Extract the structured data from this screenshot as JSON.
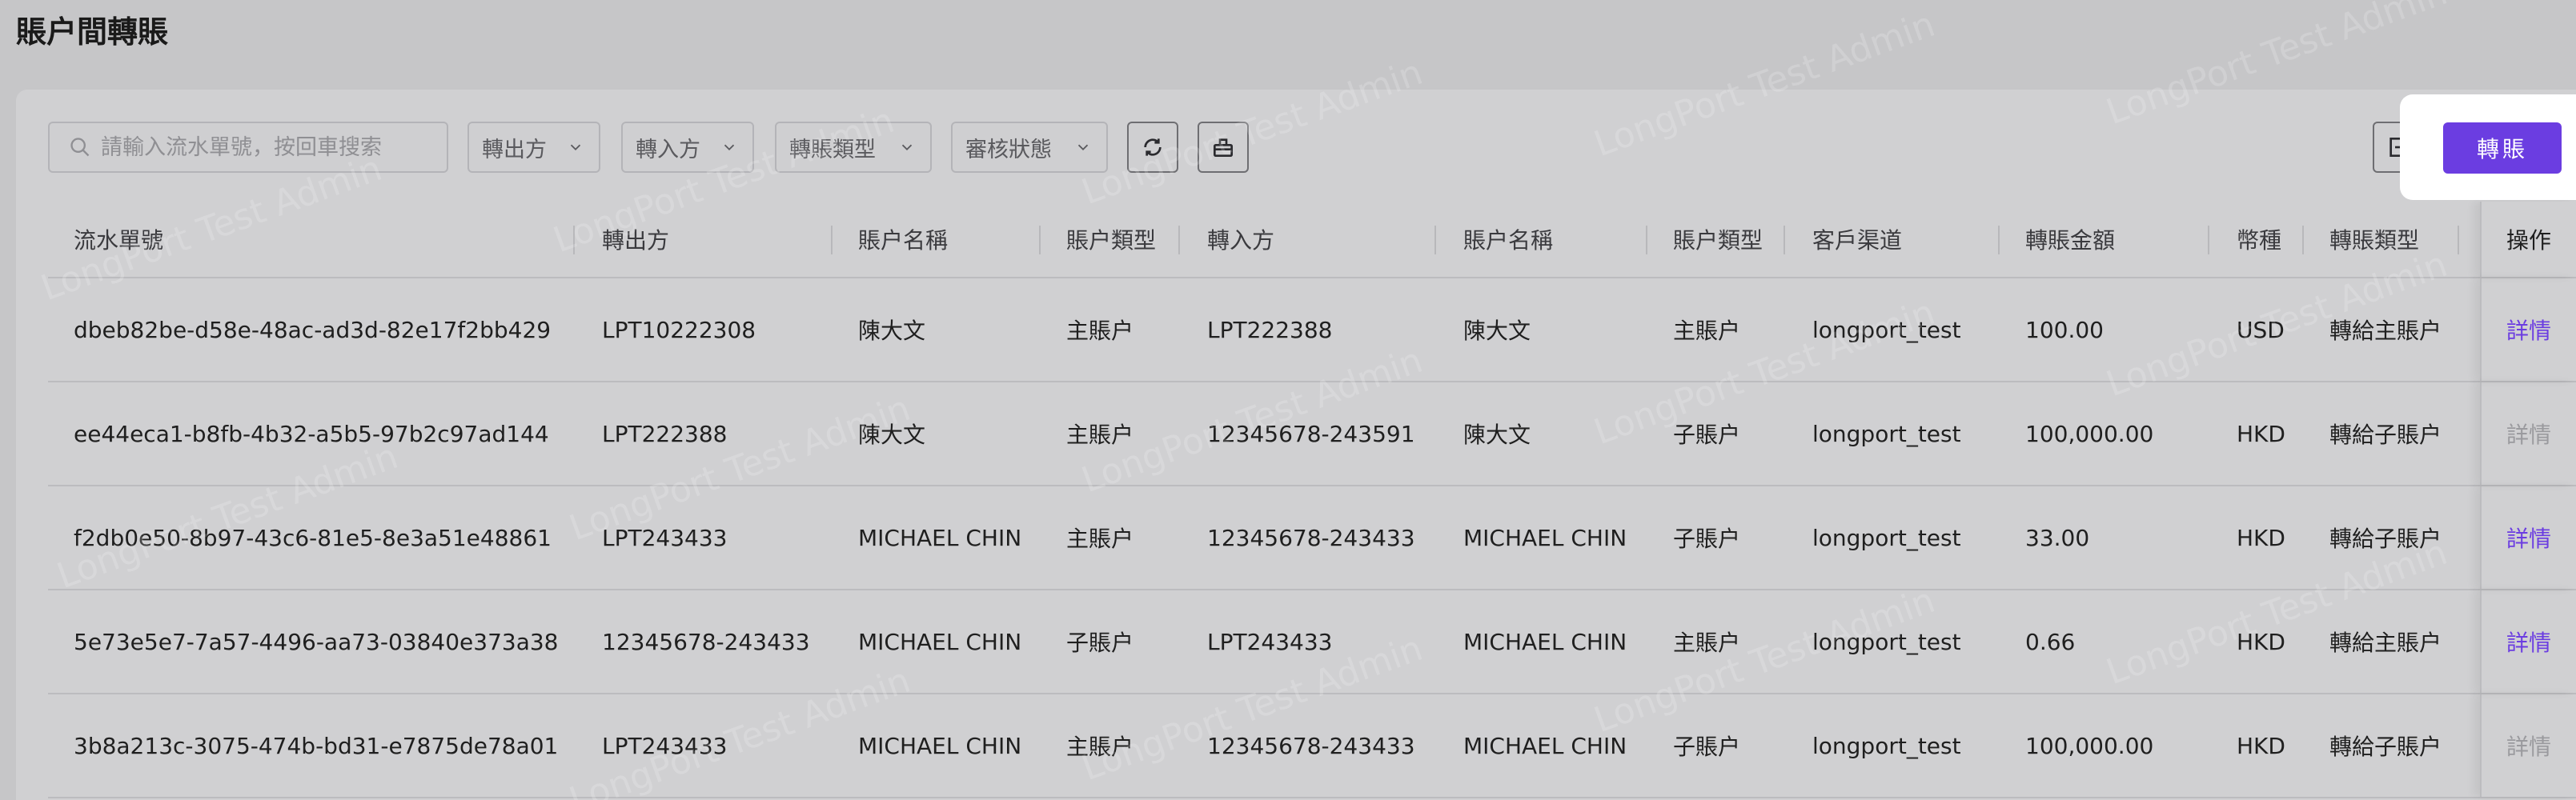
{
  "page": {
    "title": "賬户間轉賬"
  },
  "toolbar": {
    "search_placeholder": "請輸入流水單號，按回車搜索",
    "filters": [
      {
        "label": "轉出方"
      },
      {
        "label": "轉入方"
      },
      {
        "label": "轉賬類型"
      },
      {
        "label": "審核狀態"
      }
    ],
    "refresh_icon": "refresh-icon",
    "clear_icon": "eraser-icon",
    "export_icon": "export-icon",
    "transfer_label": "轉賬"
  },
  "table": {
    "columns": [
      "流水單號",
      "轉出方",
      "賬户名稱",
      "賬户類型",
      "轉入方",
      "賬户名稱",
      "賬户類型",
      "客戶渠道",
      "轉賬金額",
      "幣種",
      "轉賬類型",
      "操作"
    ],
    "rows": [
      {
        "serial": "dbeb82be-d58e-48ac-ad3d-82e17f2bb429",
        "from": "LPT10222308",
        "from_name": "陳大文",
        "from_type": "主賬户",
        "to": "LPT222388",
        "to_name": "陳大文",
        "to_type": "主賬户",
        "channel": "longport_test",
        "amount": "100.00",
        "currency": "USD",
        "transfer_type": "轉給主賬户",
        "action": "詳情",
        "action_enabled": true
      },
      {
        "serial": "ee44eca1-b8fb-4b32-a5b5-97b2c97ad144",
        "from": "LPT222388",
        "from_name": "陳大文",
        "from_type": "主賬户",
        "to": "12345678-243591",
        "to_name": "陳大文",
        "to_type": "子賬户",
        "channel": "longport_test",
        "amount": "100,000.00",
        "currency": "HKD",
        "transfer_type": "轉給子賬户",
        "action": "詳情",
        "action_enabled": false
      },
      {
        "serial": "f2db0e50-8b97-43c6-81e5-8e3a51e48861",
        "from": "LPT243433",
        "from_name": "MICHAEL CHIN",
        "from_type": "主賬户",
        "to": "12345678-243433",
        "to_name": "MICHAEL CHIN",
        "to_type": "子賬户",
        "channel": "longport_test",
        "amount": "33.00",
        "currency": "HKD",
        "transfer_type": "轉給子賬户",
        "action": "詳情",
        "action_enabled": true
      },
      {
        "serial": "5e73e5e7-7a57-4496-aa73-03840e373a38",
        "from": "12345678-243433",
        "from_name": "MICHAEL CHIN",
        "from_type": "子賬户",
        "to": "LPT243433",
        "to_name": "MICHAEL CHIN",
        "to_type": "主賬户",
        "channel": "longport_test",
        "amount": "0.66",
        "currency": "HKD",
        "transfer_type": "轉給主賬户",
        "action": "詳情",
        "action_enabled": true
      },
      {
        "serial": "3b8a213c-3075-474b-bd31-e7875de78a01",
        "from": "LPT243433",
        "from_name": "MICHAEL CHIN",
        "from_type": "主賬户",
        "to": "12345678-243433",
        "to_name": "MICHAEL CHIN",
        "to_type": "子賬户",
        "channel": "longport_test",
        "amount": "100,000.00",
        "currency": "HKD",
        "transfer_type": "轉給子賬户",
        "action": "詳情",
        "action_enabled": false
      }
    ]
  },
  "watermark": "LongPort Test Admin",
  "colors": {
    "accent": "#6b3de1",
    "disabled": "#9a9a9e"
  }
}
